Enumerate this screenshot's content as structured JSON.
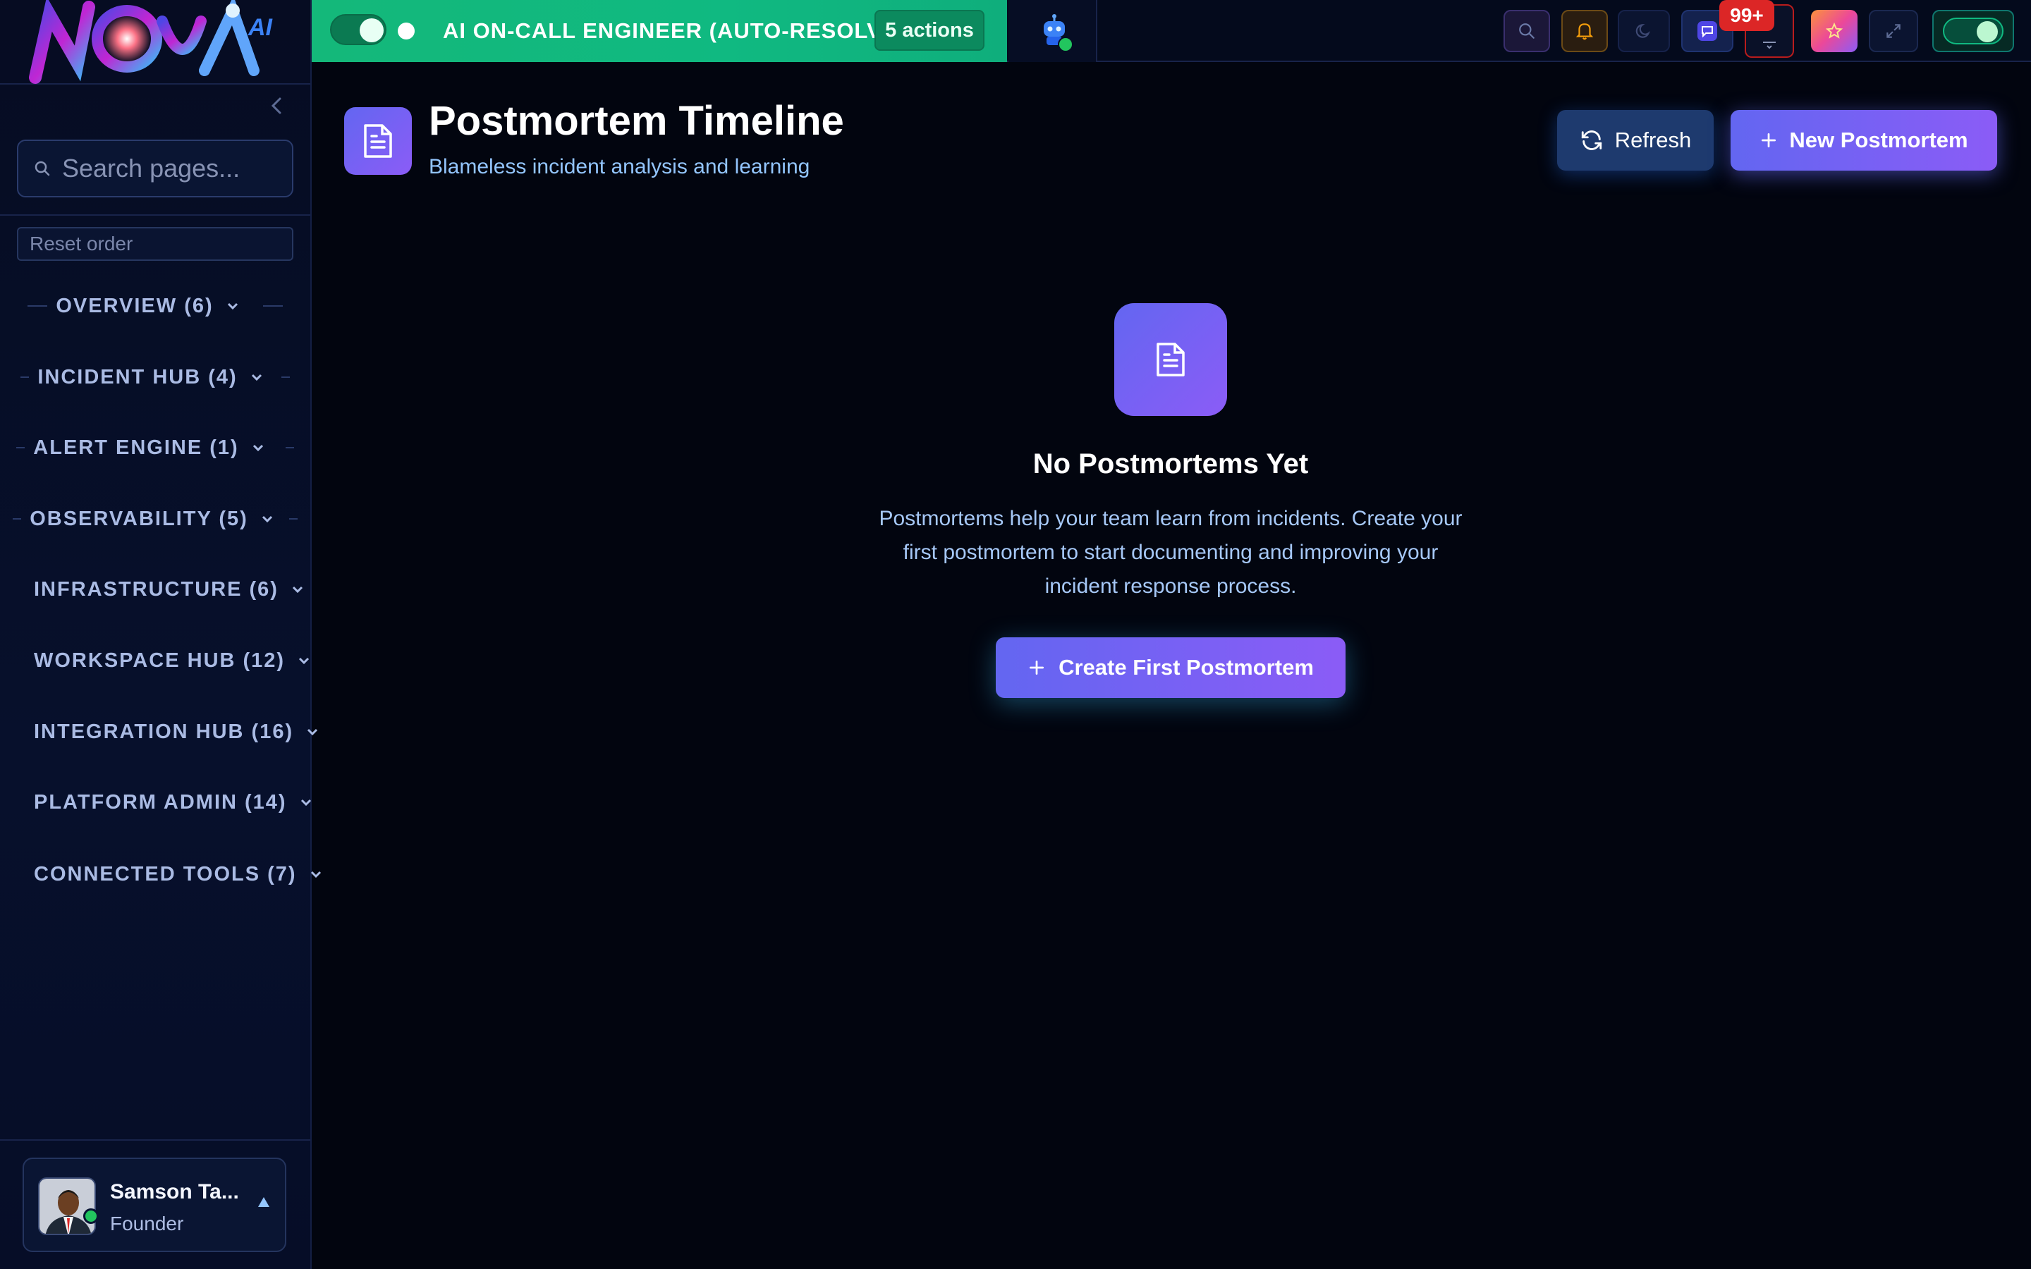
{
  "app": {
    "logo_text": "NOVA",
    "logo_suffix": "AI"
  },
  "sidebar": {
    "search_placeholder": "Search pages...",
    "reset_label": "Reset order",
    "sections": [
      {
        "label": "OVERVIEW (6)"
      },
      {
        "label": "INCIDENT HUB (4)"
      },
      {
        "label": "ALERT ENGINE (1)"
      },
      {
        "label": "OBSERVABILITY (5)"
      },
      {
        "label": "INFRASTRUCTURE (6)"
      },
      {
        "label": "WORKSPACE HUB (12)"
      },
      {
        "label": "INTEGRATION HUB (16)"
      },
      {
        "label": "PLATFORM ADMIN (14)"
      },
      {
        "label": "CONNECTED TOOLS (7)"
      }
    ],
    "user": {
      "name": "Samson Ta...",
      "role": "Founder"
    }
  },
  "topbar": {
    "banner_title": "AI ON-CALL ENGINEER (AUTO-RESOLVE)",
    "actions_badge": "5 actions",
    "notification_count": "99+"
  },
  "main": {
    "title": "Postmortem Timeline",
    "subtitle": "Blameless incident analysis and learning",
    "refresh_label": "Refresh",
    "new_label": "New Postmortem",
    "empty_title": "No Postmortems Yet",
    "empty_desc": "Postmortems help your team learn from incidents. Create your first postmortem to start documenting and improving your incident response process.",
    "create_label": "Create First Postmortem"
  },
  "colors": {
    "accent": "#6366f1",
    "accent2": "#8b5cf6",
    "banner": "#10b981",
    "danger": "#dc2626",
    "background": "#02050f"
  }
}
